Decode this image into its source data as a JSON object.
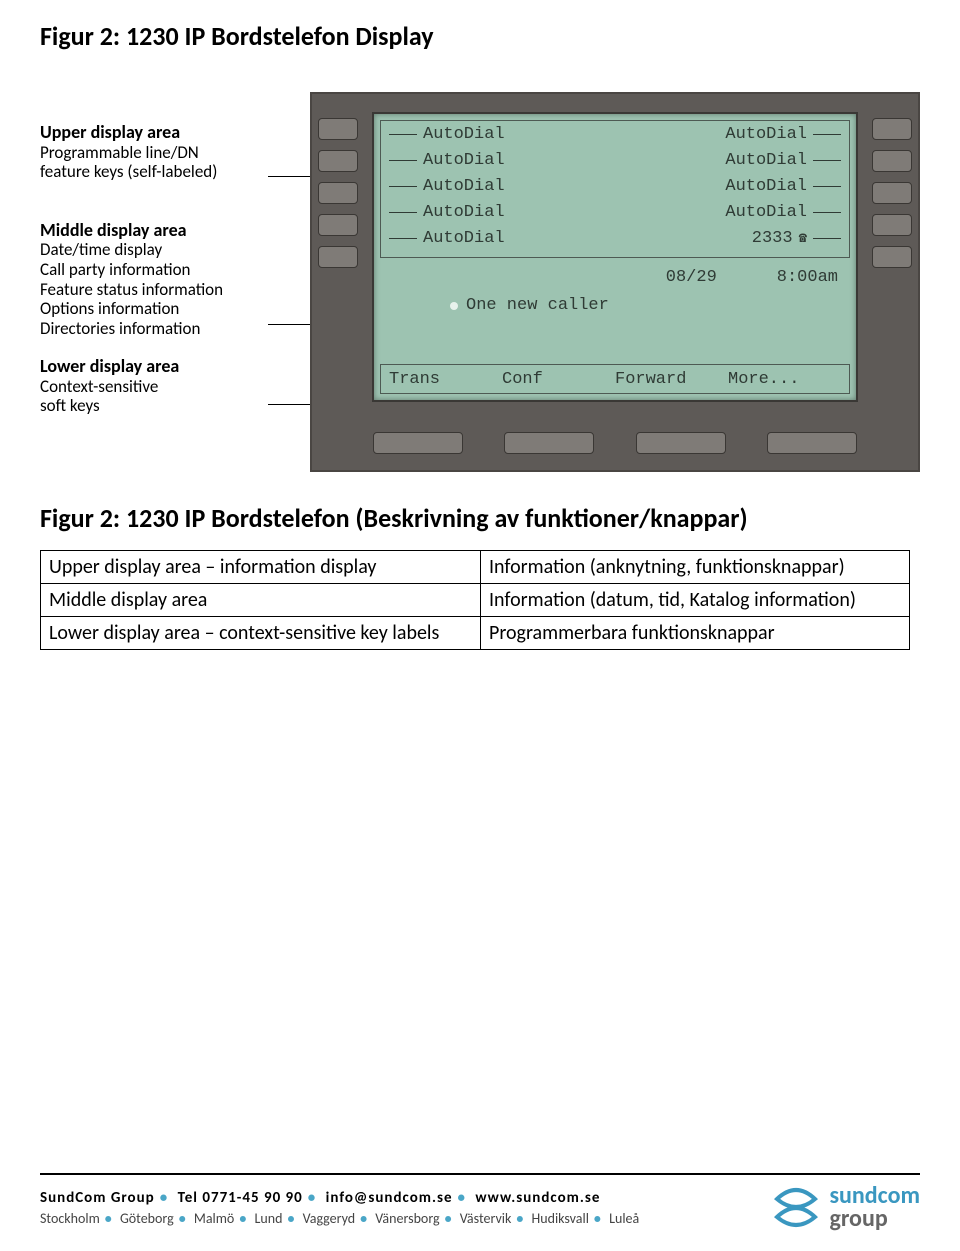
{
  "heading1": "Figur 2: 1230 IP Bordstelefon Display",
  "labels": {
    "upper": {
      "title": "Upper display area",
      "lines": [
        "Programmable line/DN",
        "feature keys (self-labeled)"
      ]
    },
    "middle": {
      "title": "Middle display area",
      "lines": [
        "Date/time display",
        "Call party information",
        "Feature status information",
        "Options information",
        "Directories information"
      ]
    },
    "lower": {
      "title": "Lower display area",
      "lines": [
        "Context-sensitive",
        "soft keys"
      ]
    }
  },
  "display": {
    "feature_rows": [
      {
        "left": "AutoDial",
        "right": "AutoDial"
      },
      {
        "left": "AutoDial",
        "right": "AutoDial"
      },
      {
        "left": "AutoDial",
        "right": "AutoDial"
      },
      {
        "left": "AutoDial",
        "right": "AutoDial"
      },
      {
        "left": "AutoDial",
        "right": "2333",
        "right_icon": "☎"
      }
    ],
    "date": "08/29",
    "time": "8:00am",
    "caller_msg": "One new caller",
    "softkeys": [
      "Trans",
      "Conf",
      "Forward",
      "More..."
    ]
  },
  "heading2": "Figur 2: 1230 IP Bordstelefon (Beskrivning av funktioner/knappar)",
  "table": [
    [
      "Upper display area – information display",
      "Information (anknytning, funktionsknappar)"
    ],
    [
      "Middle display area",
      "Information (datum, tid, Katalog information)"
    ],
    [
      "Lower display area – context-sensitive key labels",
      "Programmerbara funktionsknappar"
    ]
  ],
  "footer": {
    "line1": [
      "SundCom Group",
      "Tel 0771-45 90 90",
      "info@sundcom.se",
      "www.sundcom.se"
    ],
    "line2": [
      "Stockholm",
      "Göteborg",
      "Malmö",
      "Lund",
      "Vaggeryd",
      "Vänersborg",
      "Västervik",
      "Hudiksvall",
      "Luleå"
    ],
    "logo": {
      "top": "sundcom",
      "bottom": "group"
    }
  }
}
